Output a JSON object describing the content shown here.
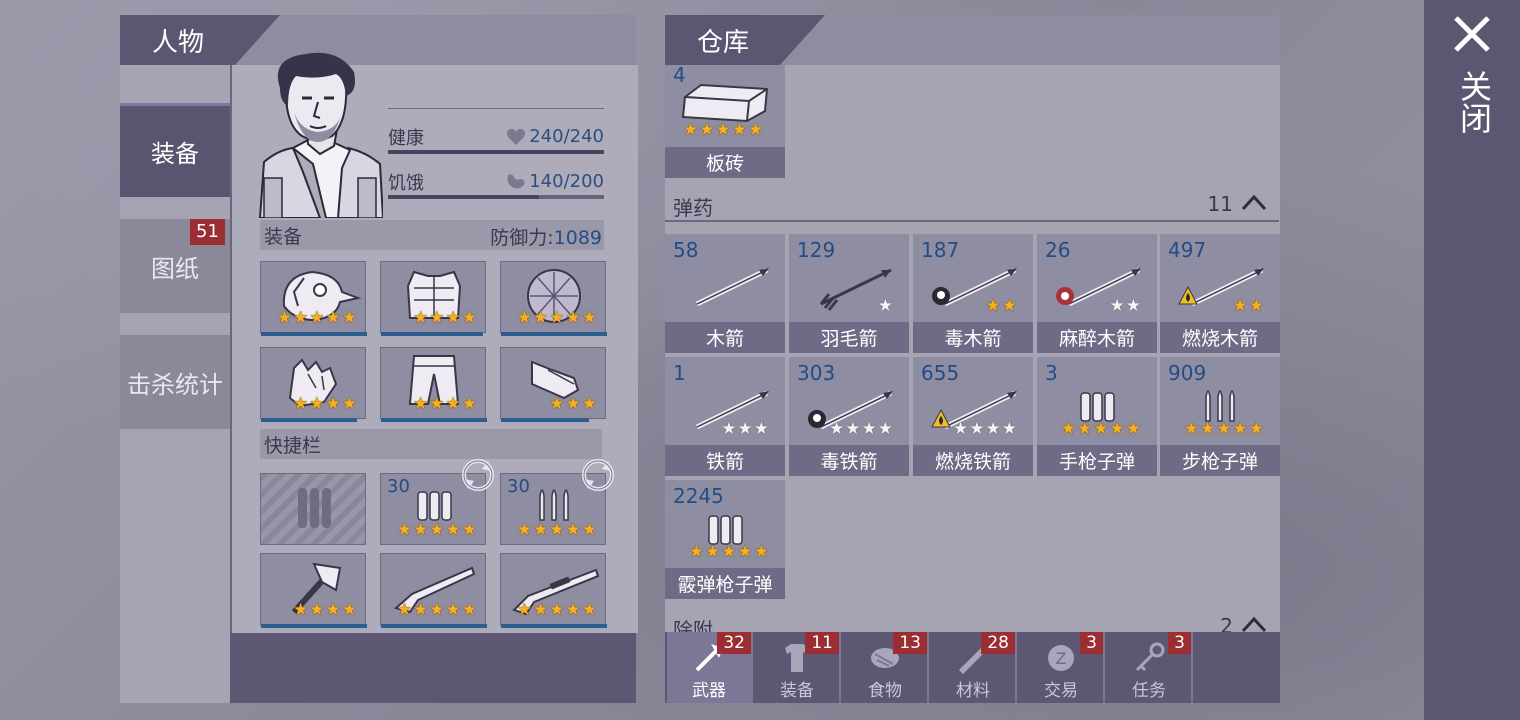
{
  "character": {
    "title": "人物",
    "nav": [
      {
        "label": "装备",
        "active": true
      },
      {
        "label": "图纸",
        "badge": "51"
      },
      {
        "label": "击杀统计"
      }
    ],
    "health": {
      "label": "健康",
      "value": "240/240",
      "fraction": 1.0
    },
    "hunger": {
      "label": "饥饿",
      "value": "140/200",
      "fraction": 0.7
    },
    "equip_section": {
      "label": "装备",
      "defense_label": "防御力:",
      "defense_value": "1089"
    },
    "equip_slots": [
      {
        "icon": "bird-mask-icon",
        "stars": 5
      },
      {
        "icon": "armor-vest-icon",
        "stars": 4
      },
      {
        "icon": "turtle-shell-icon",
        "stars": 5
      },
      {
        "icon": "gloves-icon",
        "stars": 4
      },
      {
        "icon": "pants-icon",
        "stars": 4
      },
      {
        "icon": "shoes-icon",
        "stars": 3
      }
    ],
    "quickbar_label": "快捷栏",
    "quick_slots": [
      {
        "icon": "empty-ammo-slot-icon",
        "count": "",
        "stars": 0
      },
      {
        "icon": "pistol-ammo-icon",
        "count": "30",
        "stars": 5,
        "swap": true
      },
      {
        "icon": "rifle-ammo-icon",
        "count": "30",
        "stars": 5,
        "swap": true
      },
      {
        "icon": "axe-icon",
        "count": "",
        "stars": 4
      },
      {
        "icon": "shotgun-icon",
        "count": "",
        "stars": 5
      },
      {
        "icon": "rifle-icon",
        "count": "",
        "stars": 5
      }
    ]
  },
  "warehouse": {
    "title": "仓库",
    "brick": {
      "count": "4",
      "label": "板砖",
      "stars": 5
    },
    "ammo_category": {
      "label": "弹药",
      "count": "11"
    },
    "ammo": [
      {
        "count": "58",
        "label": "木箭",
        "stars": 0,
        "white": 0,
        "badge": ""
      },
      {
        "count": "129",
        "label": "羽毛箭",
        "stars": 0,
        "white": 1,
        "badge": ""
      },
      {
        "count": "187",
        "label": "毒木箭",
        "stars": 2,
        "white": 0,
        "badge": "skull"
      },
      {
        "count": "26",
        "label": "麻醉木箭",
        "stars": 0,
        "white": 2,
        "badge": "sleep"
      },
      {
        "count": "497",
        "label": "燃烧木箭",
        "stars": 2,
        "white": 0,
        "badge": "fire"
      },
      {
        "count": "1",
        "label": "铁箭",
        "stars": 0,
        "white": 3,
        "badge": ""
      },
      {
        "count": "303",
        "label": "毒铁箭",
        "stars": 0,
        "white": 4,
        "badge": "skull"
      },
      {
        "count": "655",
        "label": "燃烧铁箭",
        "stars": 0,
        "white": 4,
        "badge": "fire"
      },
      {
        "count": "3",
        "label": "手枪子弹",
        "stars": 5,
        "white": 0,
        "badge": ""
      },
      {
        "count": "909",
        "label": "步枪子弹",
        "stars": 5,
        "white": 0,
        "badge": ""
      },
      {
        "count": "2245",
        "label": "霰弹枪子弹",
        "stars": 5,
        "white": 0,
        "badge": ""
      }
    ],
    "next_category": {
      "label": "除附",
      "count": "2"
    },
    "tabs": [
      {
        "label": "武器",
        "badge": "32",
        "icon": "axe-tab-icon",
        "active": true
      },
      {
        "label": "装备",
        "badge": "11",
        "icon": "shirt-tab-icon"
      },
      {
        "label": "食物",
        "badge": "13",
        "icon": "meat-tab-icon"
      },
      {
        "label": "材料",
        "badge": "28",
        "icon": "wood-tab-icon"
      },
      {
        "label": "交易",
        "badge": "3",
        "icon": "coin-tab-icon"
      },
      {
        "label": "任务",
        "badge": "3",
        "icon": "key-tab-icon"
      }
    ]
  },
  "close": {
    "label": "关闭"
  }
}
